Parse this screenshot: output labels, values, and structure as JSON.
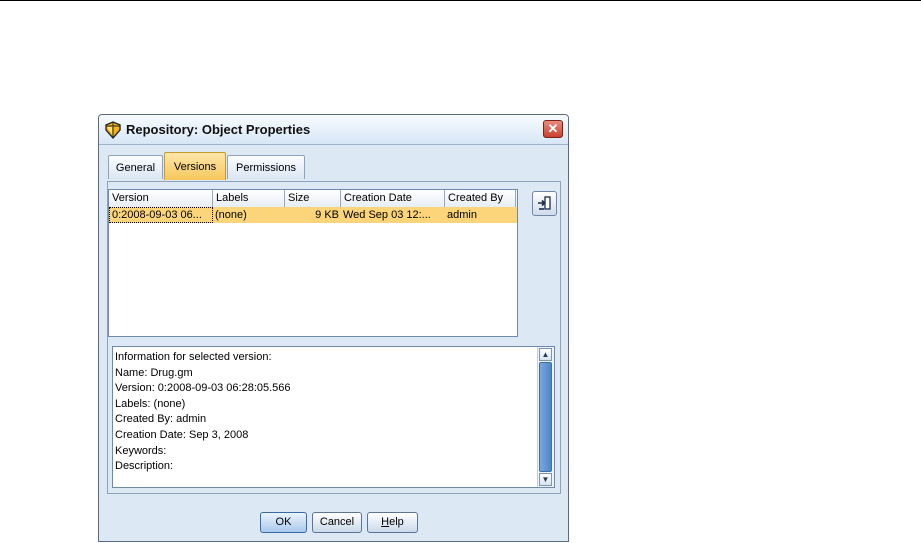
{
  "dialog": {
    "title": "Repository: Object Properties",
    "close_glyph": "✕"
  },
  "tabs": [
    {
      "label": "General",
      "active": false
    },
    {
      "label": "Versions",
      "active": true
    },
    {
      "label": "Permissions",
      "active": false
    }
  ],
  "table": {
    "columns": [
      "Version",
      "Labels",
      "Size",
      "Creation Date",
      "Created By"
    ],
    "rows": [
      [
        "0:2008-09-03 06...",
        "(none)",
        "9 KB",
        "Wed Sep 03 12:...",
        "admin"
      ]
    ]
  },
  "side_button": {
    "icon": "insert-version-icon"
  },
  "info": {
    "lines": [
      "Information for selected version:",
      "Name: Drug.gm",
      "Version: 0:2008-09-03 06:28:05.566",
      "Labels: (none)",
      "Created By: admin",
      "Creation Date: Sep 3, 2008",
      "Keywords:",
      "Description:"
    ]
  },
  "buttons": {
    "ok": "OK",
    "cancel": "Cancel",
    "help_mnemonic": "H",
    "help_rest": "elp"
  },
  "colors": {
    "selection": "#fcd57a",
    "dialog_bg": "#dce9f5"
  }
}
